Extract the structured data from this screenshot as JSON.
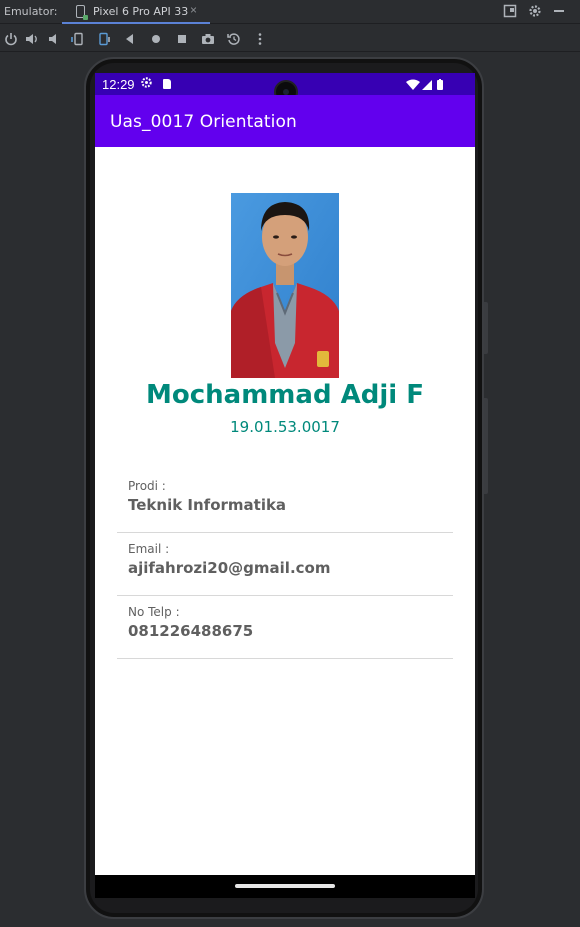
{
  "ide": {
    "emulator_label": "Emulator:",
    "device_tab": "Pixel 6 Pro API 33",
    "tab_close": "×",
    "toolbar_icons": [
      "power-icon",
      "volume-up-icon",
      "volume-down-icon",
      "rotate-left-icon",
      "rotate-right-icon",
      "back-icon",
      "home-icon",
      "overview-icon",
      "screenshot-icon",
      "snapshot-icon",
      "more-icon"
    ]
  },
  "statusbar": {
    "time": "12:29"
  },
  "app": {
    "title": "Uas_0017 Orientation"
  },
  "profile": {
    "name": "Mochammad Adji F",
    "nim": "19.01.53.0017"
  },
  "details": [
    {
      "label": "Prodi :",
      "value": "Teknik Informatika"
    },
    {
      "label": "Email :",
      "value": "ajifahrozi20@gmail.com"
    },
    {
      "label": "No Telp :",
      "value": "081226488675"
    }
  ],
  "colors": {
    "status_bar": "#3700b3",
    "app_bar": "#6200ee",
    "accent_teal": "#00897b"
  }
}
